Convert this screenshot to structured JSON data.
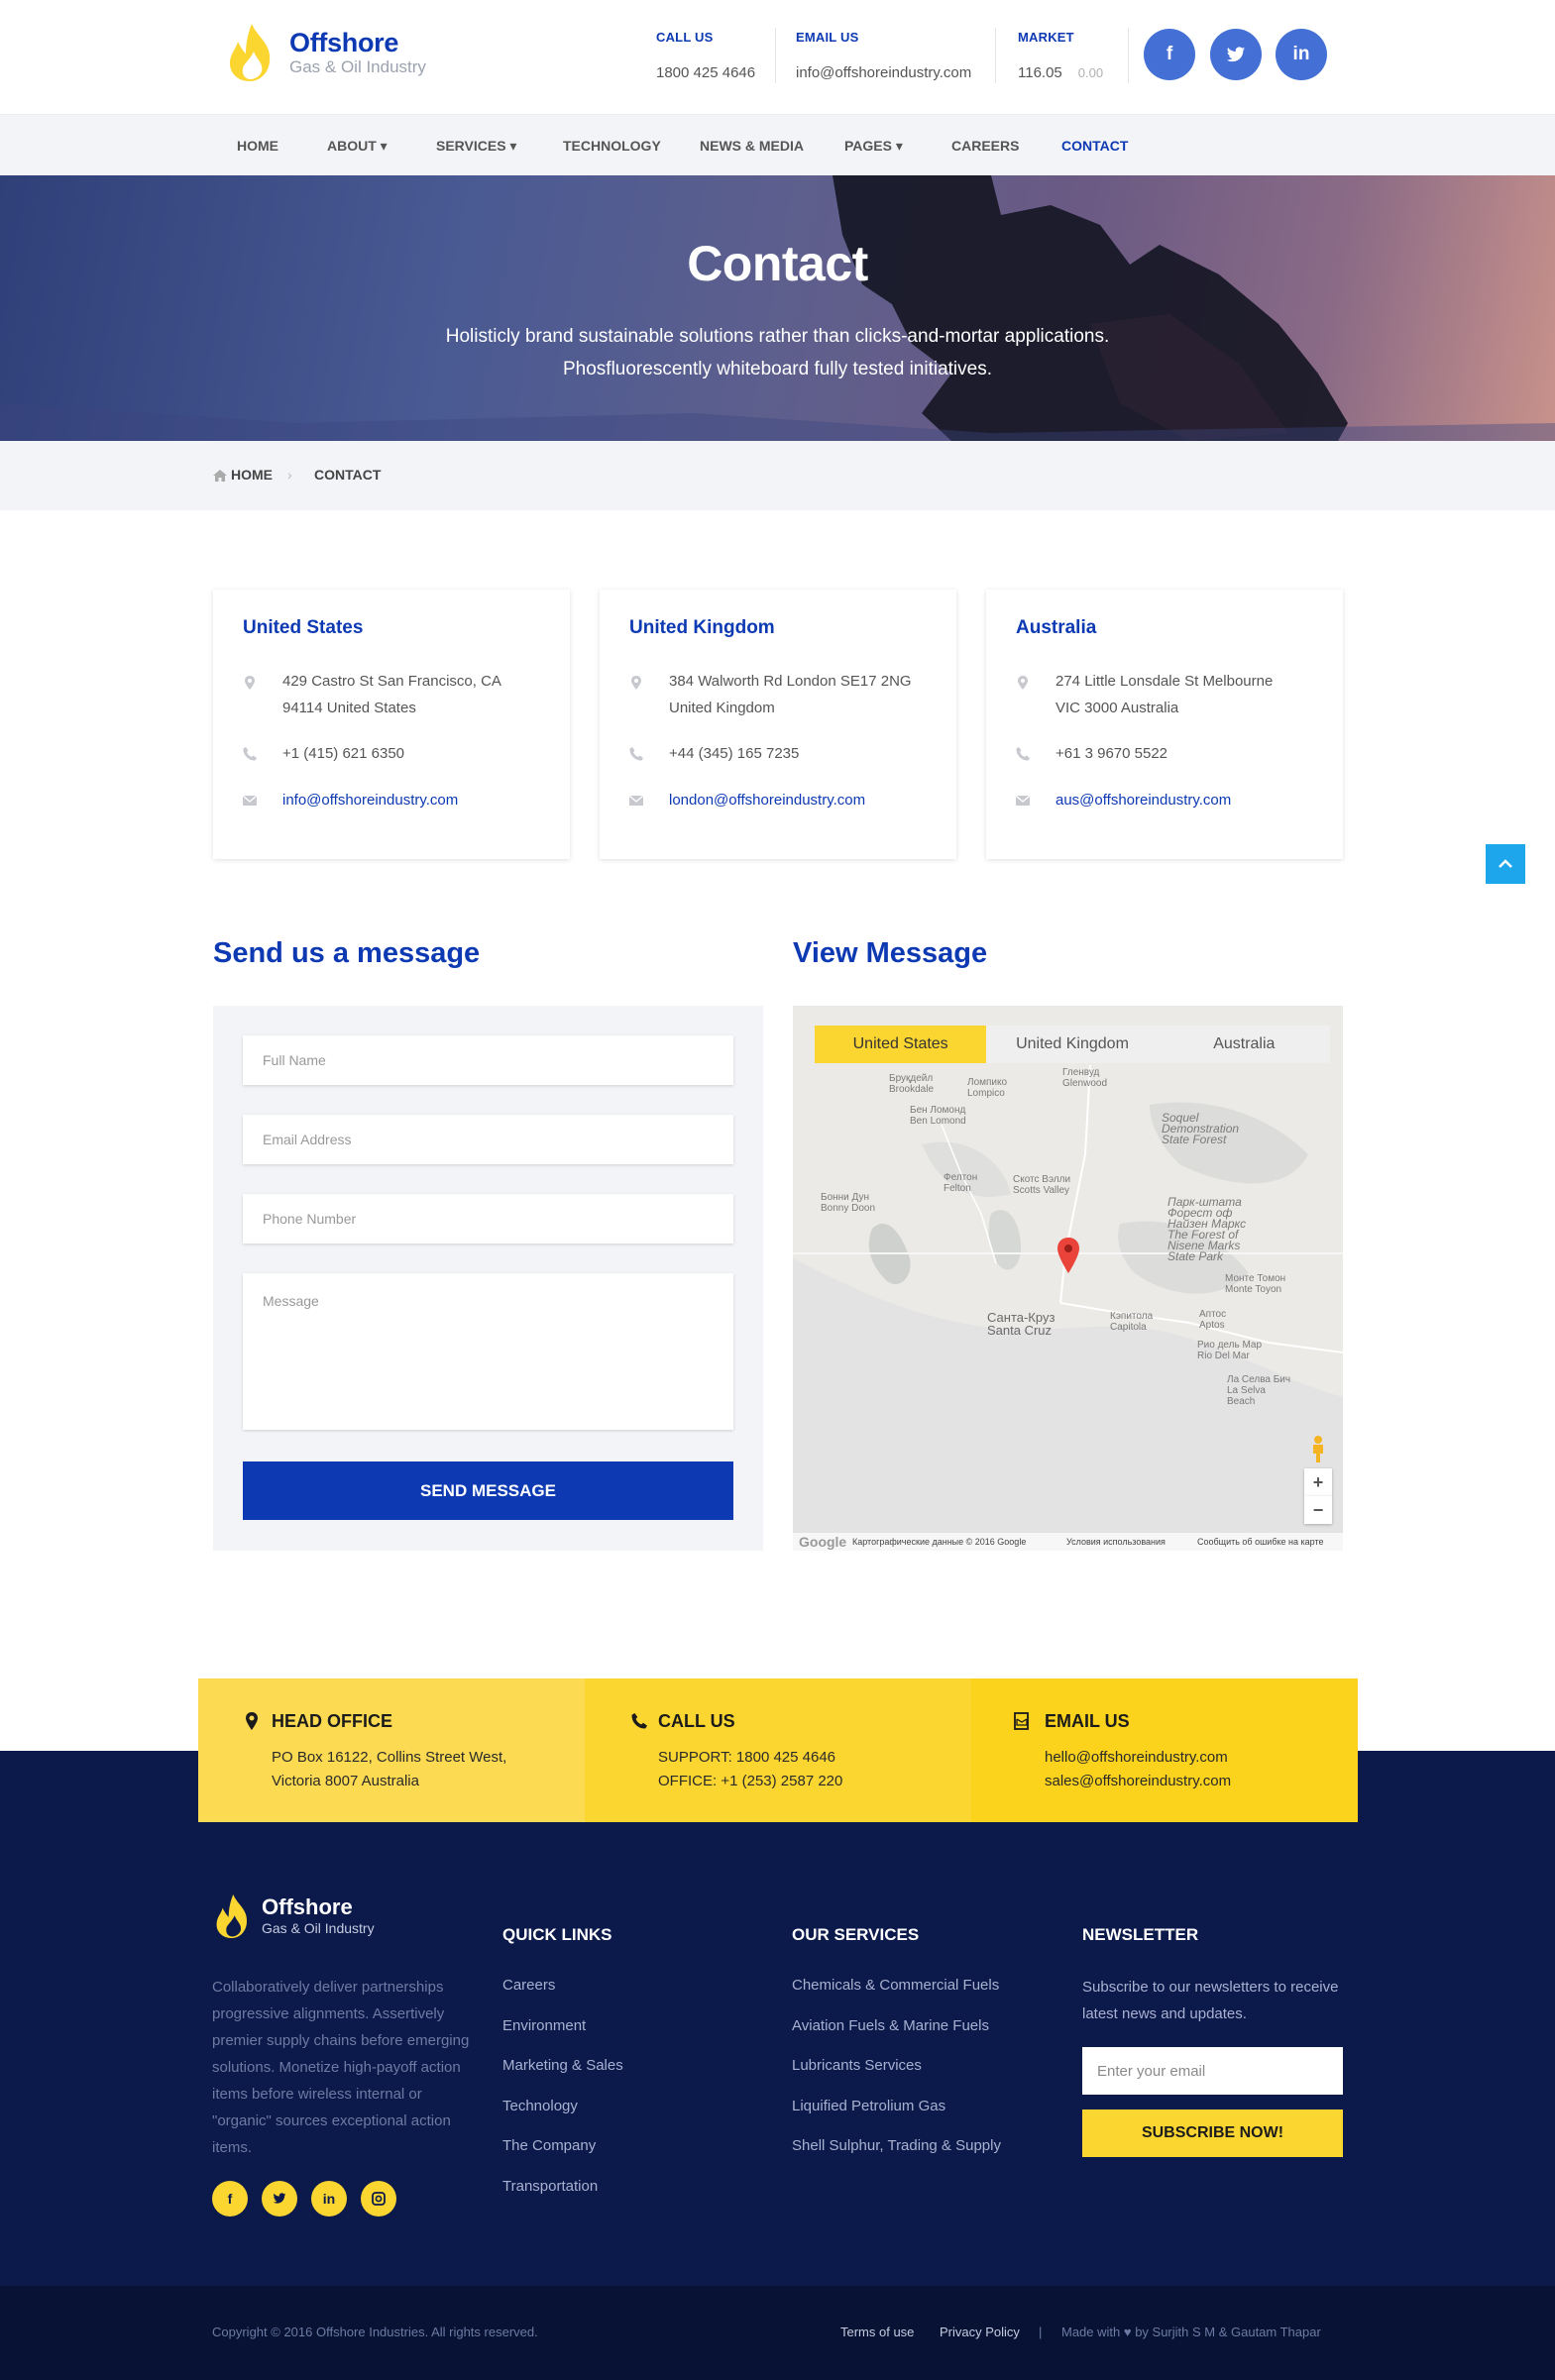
{
  "header": {
    "brand": "Offshore",
    "tagline": "Gas & Oil Industry",
    "call_us_label": "CALL US",
    "call_us_value": "1800 425 4646",
    "email_us_label": "EMAIL US",
    "email_us_value": "info@offshoreindustry.com",
    "market_label": "MARKET",
    "market_value": "116.05",
    "market_change": "0.00",
    "social": [
      "f",
      "t",
      "in"
    ]
  },
  "nav": {
    "items": [
      "HOME",
      "ABOUT ▾",
      "SERVICES ▾",
      "TECHNOLOGY",
      "NEWS & MEDIA",
      "PAGES ▾",
      "CAREERS",
      "CONTACT"
    ],
    "active": "CONTACT"
  },
  "hero": {
    "title": "Contact",
    "line1": "Holisticly brand sustainable solutions rather than clicks-and-mortar applications.",
    "line2": "Phosfluorescently whiteboard fully tested initiatives."
  },
  "breadcrumb": {
    "home": "HOME",
    "current": "CONTACT"
  },
  "offices": [
    {
      "country": "United States",
      "address1": "429 Castro St San Francisco, CA",
      "address2": "94114 United States",
      "phone": "+1 (415) 621 6350",
      "email": "info@offshoreindustry.com"
    },
    {
      "country": "United Kingdom",
      "address1": "384 Walworth Rd London SE17 2NG",
      "address2": "United Kingdom",
      "phone": "+44 (345) 165 7235",
      "email": "london@offshoreindustry.com"
    },
    {
      "country": "Australia",
      "address1": "274 Little Lonsdale St Melbourne",
      "address2": "VIC 3000 Australia",
      "phone": "+61 3 9670 5522",
      "email": "aus@offshoreindustry.com"
    }
  ],
  "form": {
    "title": "Send us a message",
    "name_placeholder": "Full Name",
    "email_placeholder": "Email Address",
    "phone_placeholder": "Phone Number",
    "message_placeholder": "Message",
    "submit": "SEND MESSAGE"
  },
  "map": {
    "title": "View Message",
    "tabs": [
      "United States",
      "United Kingdom",
      "Australia"
    ],
    "active_tab": "United States",
    "labels": {
      "brookdale": "Бруқдейл\nBrookdale",
      "lompico": "Ломпико\nLompico",
      "glenwood": "Гленвуд\nGlenwood",
      "benlomond": "Бен Ломонд\nBen Lomond",
      "soquel": "Soquel\nDemonstration\nState Forest",
      "felton": "Фелтон\nFelton",
      "scotts": "Скотс Вэлли\nScotts Valley",
      "bonnydoon": "Бонни Дун\nBonny Doon",
      "nisene": "Парк-штата\nФорест оф\nНайзен Маркс\nThe Forest of\nNisene Marks\nState Park",
      "monte": "Монте Томон\nMonte Toyon",
      "santacruz": "Санта-Круз\nSanta Cruz",
      "capitola": "Кэпитола\nCapitola",
      "aptos": "Аптос\nAptos",
      "riodelmar": "Рио дель Мар\nRio Del Mar",
      "laselva": "Ла Селва Бич\nLa Selva\nBeach"
    },
    "footer_data": "Картографические данные © 2016 Google",
    "footer_terms": "Условия использования",
    "footer_report": "Сообщить об ошибке на карте",
    "google": "Google",
    "zoom_in": "+",
    "zoom_out": "−"
  },
  "strip": {
    "office_title": "HEAD OFFICE",
    "office_l1": "PO Box 16122, Collins Street West,",
    "office_l2": "Victoria 8007 Australia",
    "call_title": "CALL US",
    "call_l1": "SUPPORT: 1800 425 4646",
    "call_l2": "OFFICE: +1 (253) 2587 220",
    "email_title": "EMAIL US",
    "email_l1": "hello@offshoreindustry.com",
    "email_l2": "sales@offshoreindustry.com"
  },
  "footer": {
    "brand": "Offshore",
    "tagline": "Gas & Oil Industry",
    "about": "Collaboratively deliver partnerships progressive alignments. Assertively premier supply chains before emerging solutions. Monetize high-payoff action items before wireless internal or \"organic\" sources exceptional action items.",
    "social": [
      "f",
      "t",
      "in",
      "ig"
    ],
    "quick_title": "QUICK LINKS",
    "quick_links": [
      "Careers",
      "Environment",
      "Marketing & Sales",
      "Technology",
      "The Company",
      "Transportation"
    ],
    "services_title": "OUR SERVICES",
    "services": [
      "Chemicals & Commercial Fuels",
      "Aviation Fuels & Marine Fuels",
      "Lubricants Services",
      "Liquified Petrolium Gas",
      "Shell Sulphur, Trading & Supply"
    ],
    "news_title": "NEWSLETTER",
    "news_text": "Subscribe to our newsletters to receive latest news and updates.",
    "news_placeholder": "Enter your email",
    "news_button": "SUBSCRIBE NOW!"
  },
  "bottom": {
    "copyright": "Copyright © 2016 Offshore Industries. All rights reserved.",
    "terms": "Terms of use",
    "privacy": "Privacy Policy",
    "sep": "|",
    "made": "Made with ♥ by Surjith S M & Gautam Thapar"
  },
  "colors": {
    "primary": "#0d3ab3",
    "accent": "#fbd530",
    "footer": "#0c1a4b"
  }
}
